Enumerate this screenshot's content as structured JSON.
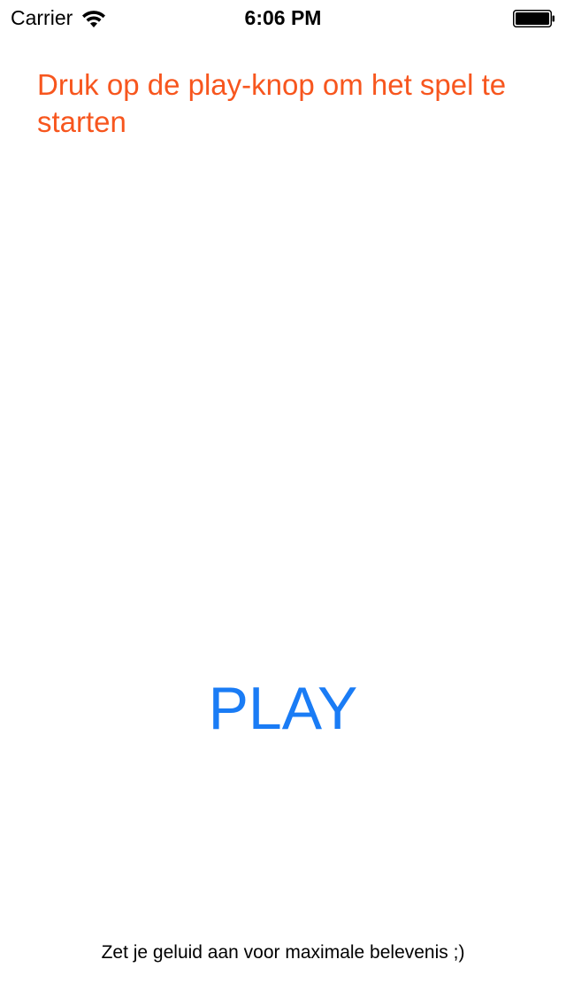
{
  "status_bar": {
    "carrier": "Carrier",
    "time": "6:06 PM",
    "wifi_icon": "wifi-icon",
    "battery_icon": "battery-full-icon"
  },
  "instruction": {
    "text": "Druk op de play-knop om het spel te starten",
    "color": "#f7561e"
  },
  "play_button": {
    "label": "PLAY",
    "color": "#1a7cf5"
  },
  "footer": {
    "hint": "Zet je geluid aan voor maximale belevenis ;)"
  }
}
